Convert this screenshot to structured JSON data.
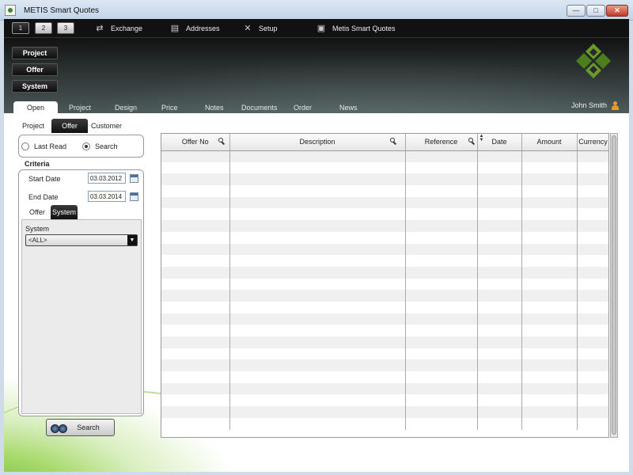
{
  "window": {
    "title": "METIS Smart Quotes",
    "min_label": "—",
    "max_label": "□",
    "close_label": "✕"
  },
  "toolbar": {
    "number_buttons": [
      "1",
      "2",
      "3"
    ],
    "exchange": "Exchange",
    "addresses": "Addresses",
    "setup": "Setup",
    "smart_quotes": "Metis Smart Quotes"
  },
  "side_buttons": [
    "Project",
    "Offer",
    "System"
  ],
  "main_tabs": [
    "Open",
    "Project",
    "Design",
    "Price",
    "Notes",
    "Documents",
    "Order",
    "News"
  ],
  "user": {
    "name": "John Smith"
  },
  "sub_tabs": [
    "Project",
    "Offer",
    "Customer"
  ],
  "radios": {
    "last_read": "Last Read",
    "search": "Search",
    "selected": "search"
  },
  "criteria": {
    "label": "Criteria",
    "start_date_label": "Start Date",
    "start_date": "03.03.2012",
    "end_date_label": "End Date",
    "end_date": "03.03.2014",
    "tabs": [
      "Offer",
      "System"
    ],
    "system_label": "System",
    "system_value": "<ALL>"
  },
  "search_button": "Search",
  "grid": {
    "columns": [
      "Offer No",
      "Description",
      "Reference",
      "Date",
      "Amount",
      "Currency"
    ]
  },
  "colors": {
    "brand_green": "#3c8a2a",
    "header_dark": "#111111"
  }
}
